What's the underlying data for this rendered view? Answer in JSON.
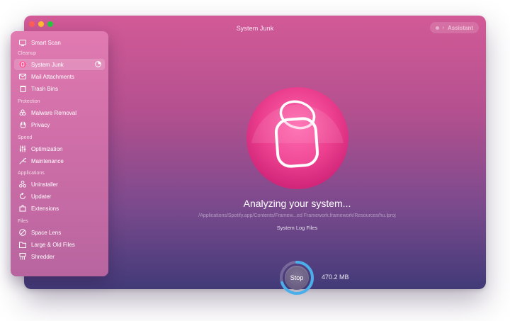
{
  "window": {
    "title": "System Junk",
    "assistant_label": "Assistant"
  },
  "sidebar": {
    "items": [
      {
        "label": "Smart Scan",
        "icon": "smart-scan-icon"
      },
      {
        "section": "Cleanup"
      },
      {
        "label": "System Junk",
        "icon": "system-junk-icon",
        "active": true
      },
      {
        "label": "Mail Attachments",
        "icon": "mail-icon"
      },
      {
        "label": "Trash Bins",
        "icon": "trash-icon"
      },
      {
        "section": "Protection"
      },
      {
        "label": "Malware Removal",
        "icon": "biohazard-icon"
      },
      {
        "label": "Privacy",
        "icon": "hand-icon"
      },
      {
        "section": "Speed"
      },
      {
        "label": "Optimization",
        "icon": "sliders-icon"
      },
      {
        "label": "Maintenance",
        "icon": "wrench-icon"
      },
      {
        "section": "Applications"
      },
      {
        "label": "Uninstaller",
        "icon": "uninstaller-icon"
      },
      {
        "label": "Updater",
        "icon": "updater-icon"
      },
      {
        "label": "Extensions",
        "icon": "extensions-icon"
      },
      {
        "section": "Files"
      },
      {
        "label": "Space Lens",
        "icon": "lens-icon"
      },
      {
        "label": "Large & Old Files",
        "icon": "folder-icon"
      },
      {
        "label": "Shredder",
        "icon": "shredder-icon"
      }
    ]
  },
  "main": {
    "status": "Analyzing your system...",
    "path": "/Applications/Spotify.app/Contents/Framew...ed Framework.framework/Resources/hu.lproj",
    "subtask": "System Log Files",
    "stop_label": "Stop",
    "size": "470.2 MB",
    "progress": 0.7
  },
  "colors": {
    "accent": "#ea4c9a",
    "progress_ring": "#4aaeea",
    "sidebar": "#d872ad"
  }
}
